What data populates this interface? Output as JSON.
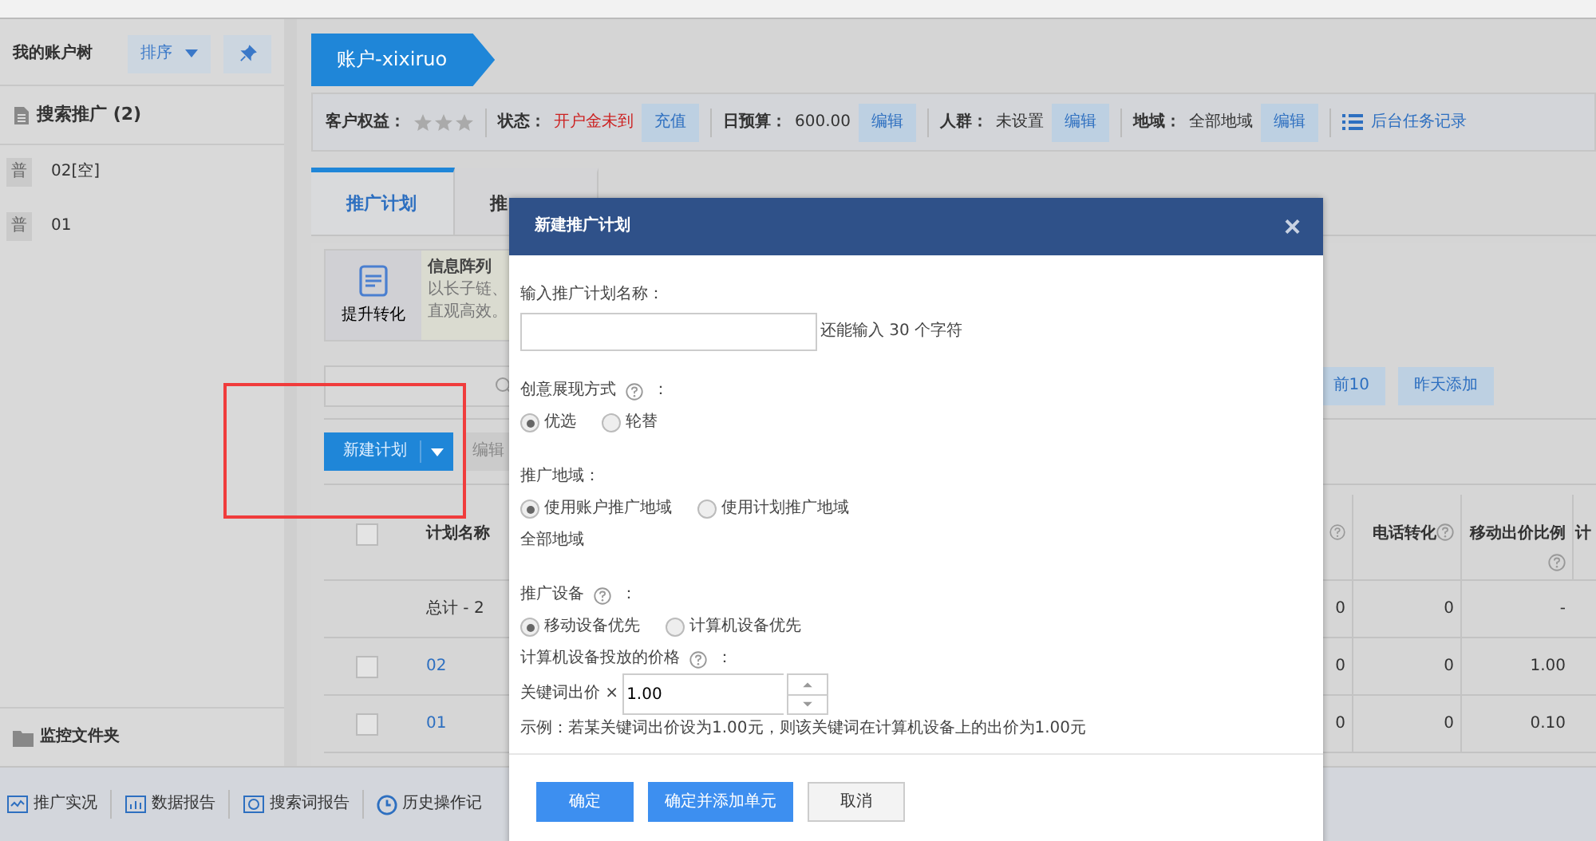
{
  "sidebar": {
    "title": "我的账户树",
    "sort_button": "排序",
    "section": "搜索推广 (2)",
    "items": [
      {
        "badge": "普",
        "label": "02[空]"
      },
      {
        "badge": "普",
        "label": "01"
      }
    ],
    "folder": "监控文件夹"
  },
  "bottom_toolbar": [
    "推广实况",
    "数据报告",
    "搜索词报告",
    "历史操作记"
  ],
  "breadcrumb": "账户-xixiruo",
  "account_bar": {
    "rights_label": "客户权益：",
    "stars": 0,
    "items": [
      {
        "label": "状态：",
        "value": "开户金未到",
        "kind": "alert",
        "button": "充值"
      },
      {
        "label": "日预算：",
        "value": "600.00",
        "kind": "normal",
        "button": "编辑"
      },
      {
        "label": "人群：",
        "value": "未设置",
        "kind": "normal",
        "button": "编辑"
      },
      {
        "label": "地域：",
        "value": "全部地域",
        "kind": "normal",
        "button": "编辑"
      }
    ],
    "task_link": "后台任务记录"
  },
  "tabs": [
    {
      "label": "推广计划",
      "selected": true
    },
    {
      "label": "推",
      "selected": false
    }
  ],
  "promo": {
    "button": "提升转化",
    "title": "信息阵列",
    "lines": [
      "以长子链、",
      "直观高效。"
    ]
  },
  "filters": [
    "前10",
    "昨天添加"
  ],
  "toolbar": {
    "new_button": "新建计划",
    "edit_button": "编辑"
  },
  "table": {
    "header_checked": false,
    "columns": [
      "计划名称",
      "电话转化",
      "移动出价比例",
      "计"
    ],
    "rows": [
      {
        "kind": "total",
        "name": "总计 - 2",
        "column_3": "0",
        "phone": "0",
        "mobile_ratio": "-"
      },
      {
        "kind": "plan",
        "checked": false,
        "name": "02",
        "column_3": "0",
        "phone": "0",
        "mobile_ratio": "1.00"
      },
      {
        "kind": "plan",
        "checked": false,
        "name": "01",
        "column_3": "0",
        "phone": "0",
        "mobile_ratio": "0.10"
      }
    ]
  },
  "dialog": {
    "title": "新建推广计划",
    "close": "×",
    "name_label": "输入推广计划名称：",
    "name_hint": "还能输入 30 个字符",
    "groups": [
      {
        "label": "创意展现方式",
        "help": true,
        "suffix": "：",
        "options": [
          {
            "label": "优选",
            "selected": true
          },
          {
            "label": "轮替",
            "selected": false
          }
        ]
      },
      {
        "label": "推广地域：",
        "options": [
          {
            "label": "使用账户推广地域",
            "selected": true
          },
          {
            "label": "使用计划推广地域",
            "selected": false
          }
        ],
        "note": "全部地域"
      },
      {
        "label": "推广设备",
        "help": true,
        "suffix": "：",
        "options": [
          {
            "label": "移动设备优先",
            "selected": true
          },
          {
            "label": "计算机设备优先",
            "selected": false
          }
        ]
      }
    ],
    "price_label": "计算机设备投放的价格",
    "price_suffix": "：",
    "bid_label": "关键词出价 ×",
    "bid_value": "1.00",
    "example": "示例：若某关键词出价设为1.00元，则该关键词在计算机设备上的出价为1.00元",
    "buttons": [
      {
        "label": "确定",
        "kind": "primary"
      },
      {
        "label": "确定并添加单元",
        "kind": "primary"
      },
      {
        "label": "取消",
        "kind": "secondary"
      }
    ]
  }
}
